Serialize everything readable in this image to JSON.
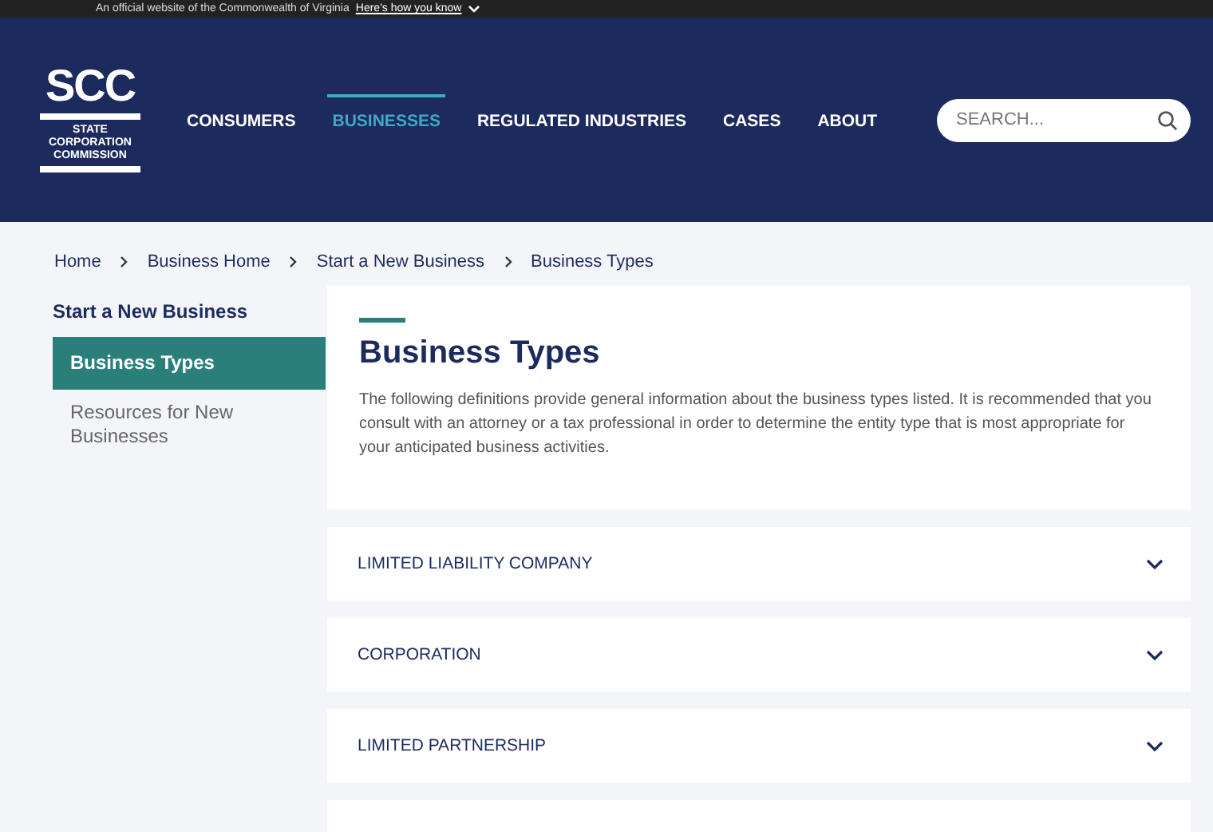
{
  "banner": {
    "text": "An official website of the Commonwealth of Virginia",
    "link": "Here's how you know"
  },
  "logo": {
    "abbr": "SCC",
    "lines": [
      "STATE",
      "CORPORATION",
      "COMMISSION"
    ]
  },
  "nav": [
    {
      "label": "CONSUMERS",
      "selected": false
    },
    {
      "label": "BUSINESSES",
      "selected": true
    },
    {
      "label": "REGULATED INDUSTRIES",
      "selected": false
    },
    {
      "label": "CASES",
      "selected": false
    },
    {
      "label": "ABOUT",
      "selected": false
    }
  ],
  "search": {
    "placeholder": "SEARCH..."
  },
  "breadcrumb": [
    "Home",
    "Business Home",
    "Start a New Business",
    "Business Types"
  ],
  "sidebar": {
    "title": "Start a New Business",
    "items": [
      {
        "label": "Business Types",
        "selected": true
      },
      {
        "label": "Resources for New Businesses",
        "selected": false
      }
    ]
  },
  "content": {
    "title": "Business Types",
    "intro": "The following definitions provide general information about the business types listed. It is recommended that you consult with an attorney or a tax professional in order to determine the entity type that is most appropriate for your anticipated business activities."
  },
  "accordions": [
    {
      "label": "LIMITED LIABILITY COMPANY",
      "expanded": false
    },
    {
      "label": "CORPORATION",
      "expanded": false
    },
    {
      "label": "LIMITED PARTNERSHIP",
      "expanded": false
    }
  ]
}
